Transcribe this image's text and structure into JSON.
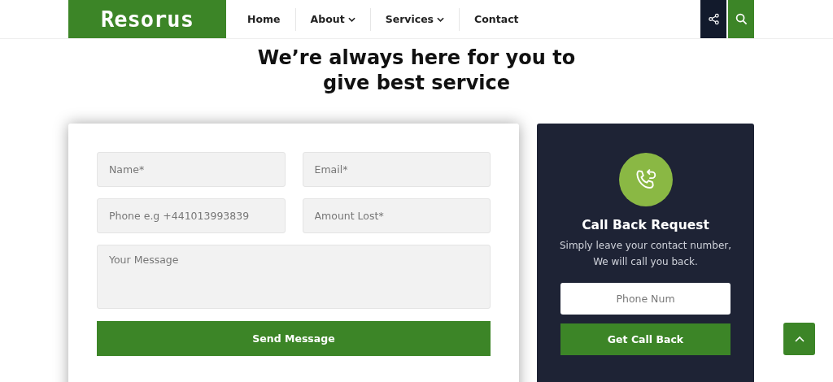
{
  "header": {
    "logo": "Resorus",
    "nav": [
      {
        "label": "Home",
        "dropdown": false
      },
      {
        "label": "About",
        "dropdown": true
      },
      {
        "label": "Services",
        "dropdown": true
      },
      {
        "label": "Contact",
        "dropdown": false
      }
    ]
  },
  "heading": "We’re always here for you to give best service",
  "contact_form": {
    "fields": [
      {
        "kind": "input",
        "placeholder": "Name*"
      },
      {
        "kind": "input",
        "placeholder": "Email*"
      },
      {
        "kind": "input",
        "placeholder": "Phone e.g +441013993839"
      },
      {
        "kind": "input",
        "placeholder": "Amount Lost*"
      },
      {
        "kind": "textarea",
        "placeholder": "Your Message"
      }
    ],
    "submit": "Send Message"
  },
  "callback": {
    "title": "Call Back Request",
    "text": "Simply leave your contact number, We will call you back.",
    "phone_placeholder": "Phone Num",
    "button": "Get Call Back"
  }
}
